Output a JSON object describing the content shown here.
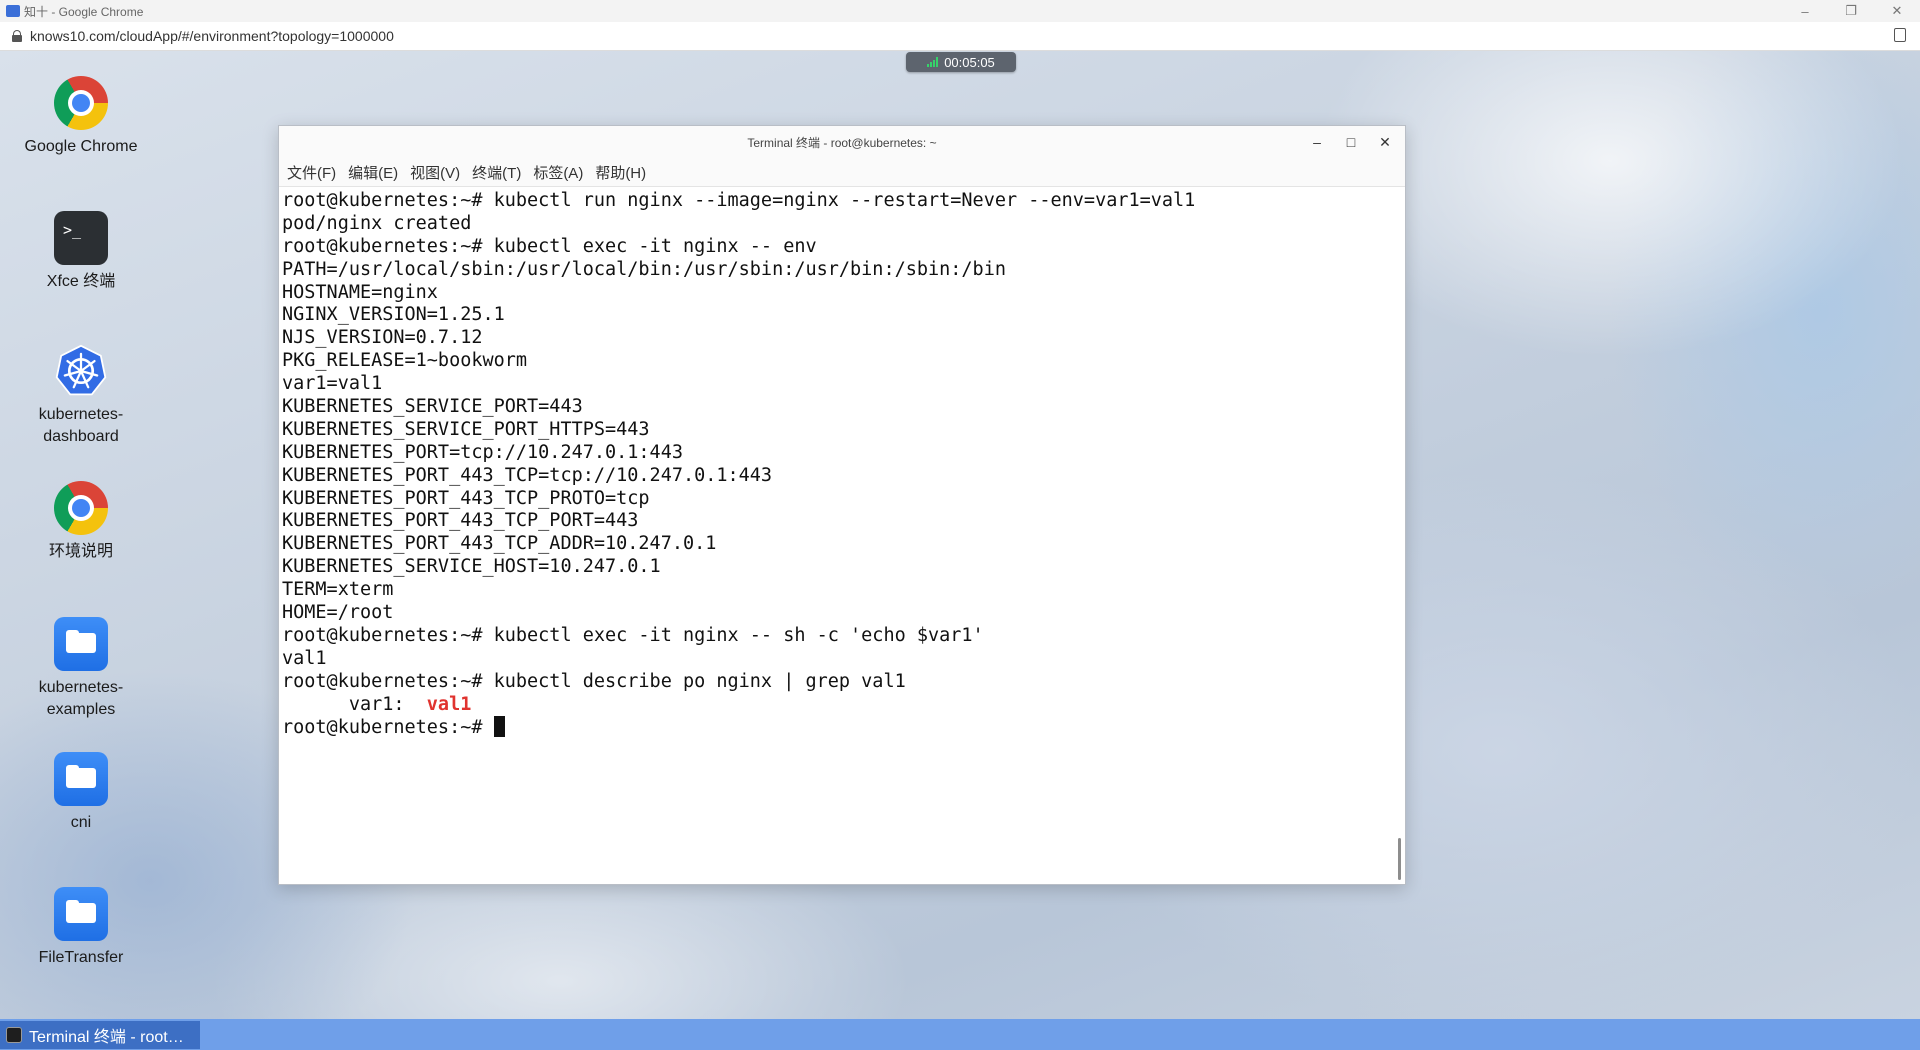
{
  "browser": {
    "window_title": "知十 - Google Chrome",
    "url": "knows10.com/cloudApp/#/environment?topology=1000000",
    "controls": {
      "minimize": "–",
      "restore": "❐",
      "close": "✕"
    }
  },
  "session": {
    "timer": "00:05:05"
  },
  "desktop": {
    "icons": [
      {
        "label": "Google Chrome",
        "icon": "chrome-icon"
      },
      {
        "label": "Xfce 终端",
        "icon": "terminal-icon"
      },
      {
        "label": "kubernetes-\ndashboard",
        "icon": "kubernetes-icon"
      },
      {
        "label": "环境说明",
        "icon": "chrome-icon"
      },
      {
        "label": "kubernetes-\nexamples",
        "icon": "folder-icon"
      },
      {
        "label": "cni",
        "icon": "folder-icon"
      },
      {
        "label": "FileTransfer",
        "icon": "folder-icon"
      }
    ]
  },
  "terminal": {
    "title": "Terminal 终端 - root@kubernetes: ~",
    "controls": {
      "minimize": "–",
      "maximize": "□",
      "close": "✕"
    },
    "menu": [
      "文件(F)",
      "编辑(E)",
      "视图(V)",
      "终端(T)",
      "标签(A)",
      "帮助(H)"
    ],
    "lines": [
      "root@kubernetes:~# kubectl run nginx --image=nginx --restart=Never --env=var1=val1",
      "pod/nginx created",
      "root@kubernetes:~# kubectl exec -it nginx -- env",
      "PATH=/usr/local/sbin:/usr/local/bin:/usr/sbin:/usr/bin:/sbin:/bin",
      "HOSTNAME=nginx",
      "NGINX_VERSION=1.25.1",
      "NJS_VERSION=0.7.12",
      "PKG_RELEASE=1~bookworm",
      "var1=val1",
      "KUBERNETES_SERVICE_PORT=443",
      "KUBERNETES_SERVICE_PORT_HTTPS=443",
      "KUBERNETES_PORT=tcp://10.247.0.1:443",
      "KUBERNETES_PORT_443_TCP=tcp://10.247.0.1:443",
      "KUBERNETES_PORT_443_TCP_PROTO=tcp",
      "KUBERNETES_PORT_443_TCP_PORT=443",
      "KUBERNETES_PORT_443_TCP_ADDR=10.247.0.1",
      "KUBERNETES_SERVICE_HOST=10.247.0.1",
      "TERM=xterm",
      "HOME=/root",
      "root@kubernetes:~# kubectl exec -it nginx -- sh -c 'echo $var1'",
      "val1",
      "root@kubernetes:~# kubectl describe po nginx | grep val1"
    ],
    "grep_line": {
      "prefix": "      var1:  ",
      "match": "val1"
    },
    "prompt": "root@kubernetes:~# "
  },
  "taskbar": {
    "item_label": "Terminal 终端 - root…"
  },
  "colors": {
    "taskbar": "#6f9fe9",
    "grep_highlight": "#e0332f",
    "timer_bg": "#5d646e"
  }
}
